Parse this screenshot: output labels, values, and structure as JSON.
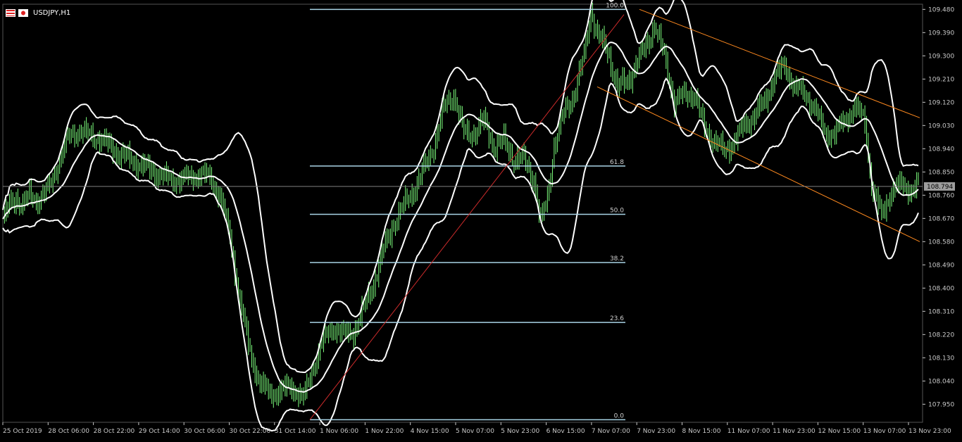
{
  "window": {
    "symbol_label": "USDJPY,H1",
    "icons": [
      "usd-flag-icon",
      "jpy-flag-icon"
    ]
  },
  "colors": {
    "background": "#000000",
    "candle": "#7cfc7c",
    "bands": "#ffffff",
    "fibo": "#a9d4e6",
    "trendline": "#cc2b2b",
    "channel": "#ff8a1f",
    "axis": "#c8c8c8",
    "price_line": "#808080",
    "price_tag_bg": "#9e9e9e"
  },
  "chart_data": {
    "type": "candlestick",
    "symbol": "USDJPY",
    "timeframe": "H1",
    "ylim": [
      107.88,
      109.5
    ],
    "y_ticks": [
      "109.480",
      "109.390",
      "109.300",
      "109.210",
      "109.120",
      "109.030",
      "108.940",
      "108.850",
      "108.760",
      "108.670",
      "108.580",
      "108.490",
      "108.400",
      "108.310",
      "108.220",
      "108.130",
      "108.040",
      "107.950"
    ],
    "x_ticks": [
      "25 Oct 2019",
      "28 Oct 06:00",
      "28 Oct 22:00",
      "29 Oct 14:00",
      "30 Oct 06:00",
      "30 Oct 22:00",
      "31 Oct 14:00",
      "1 Nov 06:00",
      "1 Nov 22:00",
      "4 Nov 15:00",
      "5 Nov 07:00",
      "5 Nov 23:00",
      "6 Nov 15:00",
      "7 Nov 07:00",
      "7 Nov 23:00",
      "8 Nov 15:00",
      "11 Nov 07:00",
      "11 Nov 23:00",
      "12 Nov 15:00",
      "13 Nov 07:00",
      "13 Nov 23:00"
    ],
    "current_price": "108.794",
    "price_path": [
      [
        0,
        108.66
      ],
      [
        4,
        108.72
      ],
      [
        8,
        108.75
      ],
      [
        12,
        108.72
      ],
      [
        16,
        108.76
      ],
      [
        20,
        108.74
      ],
      [
        24,
        108.76
      ],
      [
        28,
        108.79
      ],
      [
        34,
        108.9
      ],
      [
        40,
        108.99
      ],
      [
        46,
        109.01
      ],
      [
        52,
        108.99
      ],
      [
        58,
        108.98
      ],
      [
        64,
        108.95
      ],
      [
        70,
        108.92
      ],
      [
        76,
        108.9
      ],
      [
        82,
        108.88
      ],
      [
        88,
        108.86
      ],
      [
        94,
        108.84
      ],
      [
        100,
        108.82
      ],
      [
        106,
        108.82
      ],
      [
        112,
        108.83
      ],
      [
        118,
        108.84
      ],
      [
        124,
        108.83
      ],
      [
        130,
        108.76
      ],
      [
        136,
        108.6
      ],
      [
        142,
        108.35
      ],
      [
        148,
        108.15
      ],
      [
        154,
        108.03
      ],
      [
        160,
        107.99
      ],
      [
        166,
        108.0
      ],
      [
        172,
        108.02
      ],
      [
        176,
        108.0
      ],
      [
        180,
        107.97
      ],
      [
        186,
        108.1
      ],
      [
        192,
        108.2
      ],
      [
        198,
        108.25
      ],
      [
        204,
        108.22
      ],
      [
        210,
        108.23
      ],
      [
        216,
        108.32
      ],
      [
        222,
        108.42
      ],
      [
        228,
        108.55
      ],
      [
        234,
        108.65
      ],
      [
        240,
        108.72
      ],
      [
        246,
        108.78
      ],
      [
        252,
        108.86
      ],
      [
        258,
        108.95
      ],
      [
        264,
        109.1
      ],
      [
        270,
        109.15
      ],
      [
        276,
        109.0
      ],
      [
        282,
        109.0
      ],
      [
        288,
        109.05
      ],
      [
        294,
        108.95
      ],
      [
        300,
        108.97
      ],
      [
        306,
        108.9
      ],
      [
        312,
        108.9
      ],
      [
        318,
        108.82
      ],
      [
        322,
        108.65
      ],
      [
        326,
        108.75
      ],
      [
        330,
        108.95
      ],
      [
        336,
        109.08
      ],
      [
        342,
        109.15
      ],
      [
        348,
        109.3
      ],
      [
        352,
        109.48
      ],
      [
        356,
        109.38
      ],
      [
        362,
        109.32
      ],
      [
        368,
        109.18
      ],
      [
        374,
        109.2
      ],
      [
        380,
        109.28
      ],
      [
        386,
        109.35
      ],
      [
        390,
        109.42
      ],
      [
        396,
        109.3
      ],
      [
        402,
        109.12
      ],
      [
        408,
        109.15
      ],
      [
        414,
        109.15
      ],
      [
        420,
        109.02
      ],
      [
        426,
        108.97
      ],
      [
        432,
        108.93
      ],
      [
        438,
        108.97
      ],
      [
        444,
        109.03
      ],
      [
        450,
        109.07
      ],
      [
        456,
        109.12
      ],
      [
        462,
        109.22
      ],
      [
        468,
        109.26
      ],
      [
        474,
        109.18
      ],
      [
        480,
        109.15
      ],
      [
        486,
        109.1
      ],
      [
        492,
        109.0
      ],
      [
        498,
        109.0
      ],
      [
        504,
        109.05
      ],
      [
        510,
        109.1
      ],
      [
        516,
        109.05
      ],
      [
        520,
        108.8
      ],
      [
        526,
        108.68
      ],
      [
        532,
        108.78
      ],
      [
        538,
        108.8
      ],
      [
        544,
        108.78
      ],
      [
        548,
        108.8
      ]
    ],
    "fibonacci": {
      "levels": [
        {
          "label": "100.0",
          "price": 109.48
        },
        {
          "label": "61.8",
          "price": 108.873
        },
        {
          "label": "50.0",
          "price": 108.686
        },
        {
          "label": "38.2",
          "price": 108.499
        },
        {
          "label": "23.6",
          "price": 108.267
        },
        {
          "label": "0.0",
          "price": 107.89
        }
      ]
    },
    "trendline": {
      "from": [
        107.89
      ],
      "to": [
        109.46
      ]
    },
    "channel": {
      "upper": [
        109.48,
        109.06
      ],
      "lower": [
        109.18,
        108.58
      ]
    }
  }
}
